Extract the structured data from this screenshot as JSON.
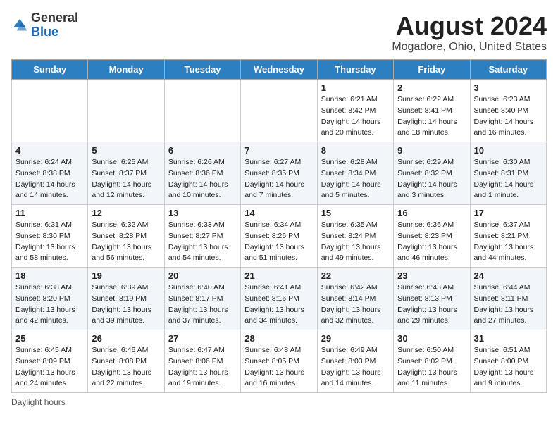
{
  "header": {
    "logo_general": "General",
    "logo_blue": "Blue",
    "main_title": "August 2024",
    "subtitle": "Mogadore, Ohio, United States"
  },
  "weekdays": [
    "Sunday",
    "Monday",
    "Tuesday",
    "Wednesday",
    "Thursday",
    "Friday",
    "Saturday"
  ],
  "footer": {
    "daylight_label": "Daylight hours"
  },
  "weeks": [
    [
      {
        "day": "",
        "sunrise": "",
        "sunset": "",
        "daylight": ""
      },
      {
        "day": "",
        "sunrise": "",
        "sunset": "",
        "daylight": ""
      },
      {
        "day": "",
        "sunrise": "",
        "sunset": "",
        "daylight": ""
      },
      {
        "day": "",
        "sunrise": "",
        "sunset": "",
        "daylight": ""
      },
      {
        "day": "1",
        "sunrise": "Sunrise: 6:21 AM",
        "sunset": "Sunset: 8:42 PM",
        "daylight": "Daylight: 14 hours and 20 minutes."
      },
      {
        "day": "2",
        "sunrise": "Sunrise: 6:22 AM",
        "sunset": "Sunset: 8:41 PM",
        "daylight": "Daylight: 14 hours and 18 minutes."
      },
      {
        "day": "3",
        "sunrise": "Sunrise: 6:23 AM",
        "sunset": "Sunset: 8:40 PM",
        "daylight": "Daylight: 14 hours and 16 minutes."
      }
    ],
    [
      {
        "day": "4",
        "sunrise": "Sunrise: 6:24 AM",
        "sunset": "Sunset: 8:38 PM",
        "daylight": "Daylight: 14 hours and 14 minutes."
      },
      {
        "day": "5",
        "sunrise": "Sunrise: 6:25 AM",
        "sunset": "Sunset: 8:37 PM",
        "daylight": "Daylight: 14 hours and 12 minutes."
      },
      {
        "day": "6",
        "sunrise": "Sunrise: 6:26 AM",
        "sunset": "Sunset: 8:36 PM",
        "daylight": "Daylight: 14 hours and 10 minutes."
      },
      {
        "day": "7",
        "sunrise": "Sunrise: 6:27 AM",
        "sunset": "Sunset: 8:35 PM",
        "daylight": "Daylight: 14 hours and 7 minutes."
      },
      {
        "day": "8",
        "sunrise": "Sunrise: 6:28 AM",
        "sunset": "Sunset: 8:34 PM",
        "daylight": "Daylight: 14 hours and 5 minutes."
      },
      {
        "day": "9",
        "sunrise": "Sunrise: 6:29 AM",
        "sunset": "Sunset: 8:32 PM",
        "daylight": "Daylight: 14 hours and 3 minutes."
      },
      {
        "day": "10",
        "sunrise": "Sunrise: 6:30 AM",
        "sunset": "Sunset: 8:31 PM",
        "daylight": "Daylight: 14 hours and 1 minute."
      }
    ],
    [
      {
        "day": "11",
        "sunrise": "Sunrise: 6:31 AM",
        "sunset": "Sunset: 8:30 PM",
        "daylight": "Daylight: 13 hours and 58 minutes."
      },
      {
        "day": "12",
        "sunrise": "Sunrise: 6:32 AM",
        "sunset": "Sunset: 8:28 PM",
        "daylight": "Daylight: 13 hours and 56 minutes."
      },
      {
        "day": "13",
        "sunrise": "Sunrise: 6:33 AM",
        "sunset": "Sunset: 8:27 PM",
        "daylight": "Daylight: 13 hours and 54 minutes."
      },
      {
        "day": "14",
        "sunrise": "Sunrise: 6:34 AM",
        "sunset": "Sunset: 8:26 PM",
        "daylight": "Daylight: 13 hours and 51 minutes."
      },
      {
        "day": "15",
        "sunrise": "Sunrise: 6:35 AM",
        "sunset": "Sunset: 8:24 PM",
        "daylight": "Daylight: 13 hours and 49 minutes."
      },
      {
        "day": "16",
        "sunrise": "Sunrise: 6:36 AM",
        "sunset": "Sunset: 8:23 PM",
        "daylight": "Daylight: 13 hours and 46 minutes."
      },
      {
        "day": "17",
        "sunrise": "Sunrise: 6:37 AM",
        "sunset": "Sunset: 8:21 PM",
        "daylight": "Daylight: 13 hours and 44 minutes."
      }
    ],
    [
      {
        "day": "18",
        "sunrise": "Sunrise: 6:38 AM",
        "sunset": "Sunset: 8:20 PM",
        "daylight": "Daylight: 13 hours and 42 minutes."
      },
      {
        "day": "19",
        "sunrise": "Sunrise: 6:39 AM",
        "sunset": "Sunset: 8:19 PM",
        "daylight": "Daylight: 13 hours and 39 minutes."
      },
      {
        "day": "20",
        "sunrise": "Sunrise: 6:40 AM",
        "sunset": "Sunset: 8:17 PM",
        "daylight": "Daylight: 13 hours and 37 minutes."
      },
      {
        "day": "21",
        "sunrise": "Sunrise: 6:41 AM",
        "sunset": "Sunset: 8:16 PM",
        "daylight": "Daylight: 13 hours and 34 minutes."
      },
      {
        "day": "22",
        "sunrise": "Sunrise: 6:42 AM",
        "sunset": "Sunset: 8:14 PM",
        "daylight": "Daylight: 13 hours and 32 minutes."
      },
      {
        "day": "23",
        "sunrise": "Sunrise: 6:43 AM",
        "sunset": "Sunset: 8:13 PM",
        "daylight": "Daylight: 13 hours and 29 minutes."
      },
      {
        "day": "24",
        "sunrise": "Sunrise: 6:44 AM",
        "sunset": "Sunset: 8:11 PM",
        "daylight": "Daylight: 13 hours and 27 minutes."
      }
    ],
    [
      {
        "day": "25",
        "sunrise": "Sunrise: 6:45 AM",
        "sunset": "Sunset: 8:09 PM",
        "daylight": "Daylight: 13 hours and 24 minutes."
      },
      {
        "day": "26",
        "sunrise": "Sunrise: 6:46 AM",
        "sunset": "Sunset: 8:08 PM",
        "daylight": "Daylight: 13 hours and 22 minutes."
      },
      {
        "day": "27",
        "sunrise": "Sunrise: 6:47 AM",
        "sunset": "Sunset: 8:06 PM",
        "daylight": "Daylight: 13 hours and 19 minutes."
      },
      {
        "day": "28",
        "sunrise": "Sunrise: 6:48 AM",
        "sunset": "Sunset: 8:05 PM",
        "daylight": "Daylight: 13 hours and 16 minutes."
      },
      {
        "day": "29",
        "sunrise": "Sunrise: 6:49 AM",
        "sunset": "Sunset: 8:03 PM",
        "daylight": "Daylight: 13 hours and 14 minutes."
      },
      {
        "day": "30",
        "sunrise": "Sunrise: 6:50 AM",
        "sunset": "Sunset: 8:02 PM",
        "daylight": "Daylight: 13 hours and 11 minutes."
      },
      {
        "day": "31",
        "sunrise": "Sunrise: 6:51 AM",
        "sunset": "Sunset: 8:00 PM",
        "daylight": "Daylight: 13 hours and 9 minutes."
      }
    ]
  ]
}
